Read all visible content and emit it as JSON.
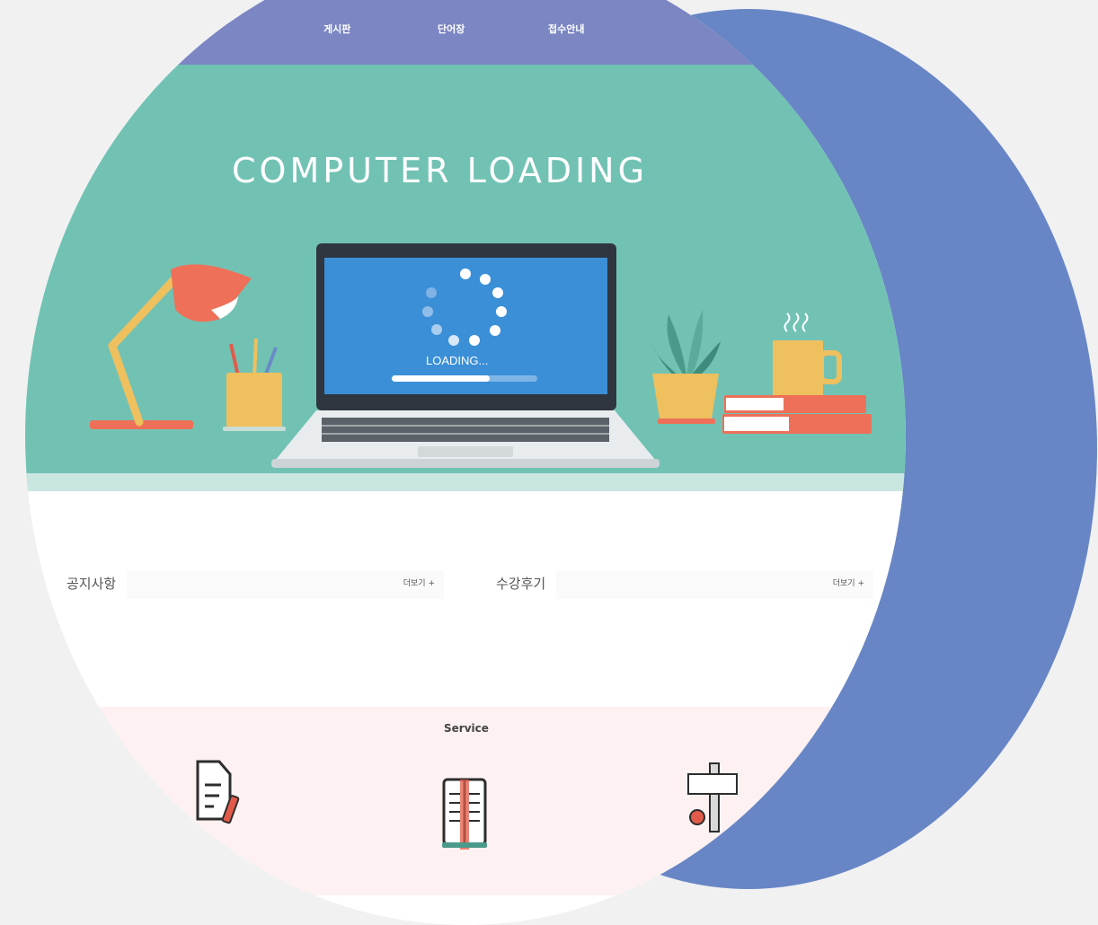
{
  "nav": {
    "items": [
      "게시판",
      "단어장",
      "접수안내"
    ]
  },
  "hero": {
    "title": "COMPUTER LOADING",
    "loading_label": "LOADING...",
    "loading_progress": 0.67
  },
  "boards": [
    {
      "title": "공지사항",
      "more": "더보기 +"
    },
    {
      "title": "수강후기",
      "more": "더보기 +"
    }
  ],
  "service": {
    "title": "Service"
  },
  "colors": {
    "background": "#f1f1f2",
    "accent_disc": "#6886c5",
    "nav": "#7b86c2",
    "hero": "#72c2b4"
  }
}
